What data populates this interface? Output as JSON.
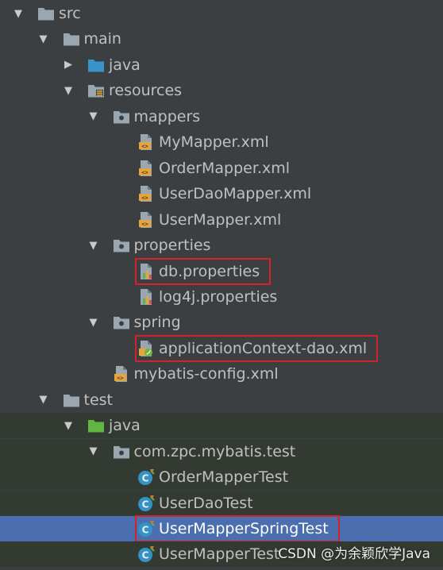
{
  "tree": {
    "nodes": [
      {
        "label": "src",
        "depth": 0,
        "arrow": "down",
        "icon": "folder-icon",
        "folder_kind": "plain"
      },
      {
        "label": "main",
        "depth": 1,
        "arrow": "down",
        "icon": "folder-icon",
        "folder_kind": "plain"
      },
      {
        "label": "java",
        "depth": 2,
        "arrow": "right",
        "icon": "folder-icon",
        "folder_kind": "source"
      },
      {
        "label": "resources",
        "depth": 2,
        "arrow": "down",
        "icon": "resources-folder-icon",
        "folder_kind": "resources"
      },
      {
        "label": "mappers",
        "depth": 3,
        "arrow": "down",
        "icon": "package-icon",
        "folder_kind": "package"
      },
      {
        "label": "MyMapper.xml",
        "depth": 4,
        "icon": "xml-file-icon"
      },
      {
        "label": "OrderMapper.xml",
        "depth": 4,
        "icon": "xml-file-icon"
      },
      {
        "label": "UserDaoMapper.xml",
        "depth": 4,
        "icon": "xml-file-icon"
      },
      {
        "label": "UserMapper.xml",
        "depth": 4,
        "icon": "xml-file-icon"
      },
      {
        "label": "properties",
        "depth": 3,
        "arrow": "down",
        "icon": "package-icon",
        "folder_kind": "package"
      },
      {
        "label": "db.properties",
        "depth": 4,
        "icon": "properties-file-icon",
        "highlighted": true
      },
      {
        "label": "log4j.properties",
        "depth": 4,
        "icon": "properties-file-icon"
      },
      {
        "label": "spring",
        "depth": 3,
        "arrow": "down",
        "icon": "package-icon",
        "folder_kind": "package"
      },
      {
        "label": "applicationContext-dao.xml",
        "depth": 4,
        "icon": "spring-xml-file-icon",
        "highlighted": true
      },
      {
        "label": "mybatis-config.xml",
        "depth": 3,
        "icon": "xml-file-icon"
      },
      {
        "label": "test",
        "depth": 1,
        "arrow": "down",
        "icon": "folder-icon",
        "folder_kind": "plain"
      },
      {
        "label": "java",
        "depth": 2,
        "arrow": "down",
        "icon": "test-folder-icon",
        "folder_kind": "test",
        "green": true
      },
      {
        "label": "com.zpc.mybatis.test",
        "depth": 3,
        "arrow": "down",
        "icon": "package-icon",
        "folder_kind": "package",
        "green": true
      },
      {
        "label": "OrderMapperTest",
        "depth": 4,
        "icon": "test-class-icon",
        "green": true
      },
      {
        "label": "UserDaoTest",
        "depth": 4,
        "icon": "test-class-icon",
        "green": true
      },
      {
        "label": "UserMapperSpringTest",
        "depth": 4,
        "icon": "test-class-icon",
        "selected": true,
        "highlighted": true
      },
      {
        "label": "UserMapperTest",
        "depth": 4,
        "icon": "test-class-icon",
        "green": true
      }
    ]
  },
  "colors": {
    "background": "#3c3f41",
    "selection": "#4b6eaf",
    "test_area": "#333a32",
    "highlight_box": "#d0232b",
    "folder": "#9aa7b0",
    "source_folder": "#3a94c8",
    "test_folder": "#62b543",
    "xml_badge": "#e8a33d",
    "class_icon": "#3592c4"
  },
  "watermark": "CSDN @为余颖欣学Java"
}
